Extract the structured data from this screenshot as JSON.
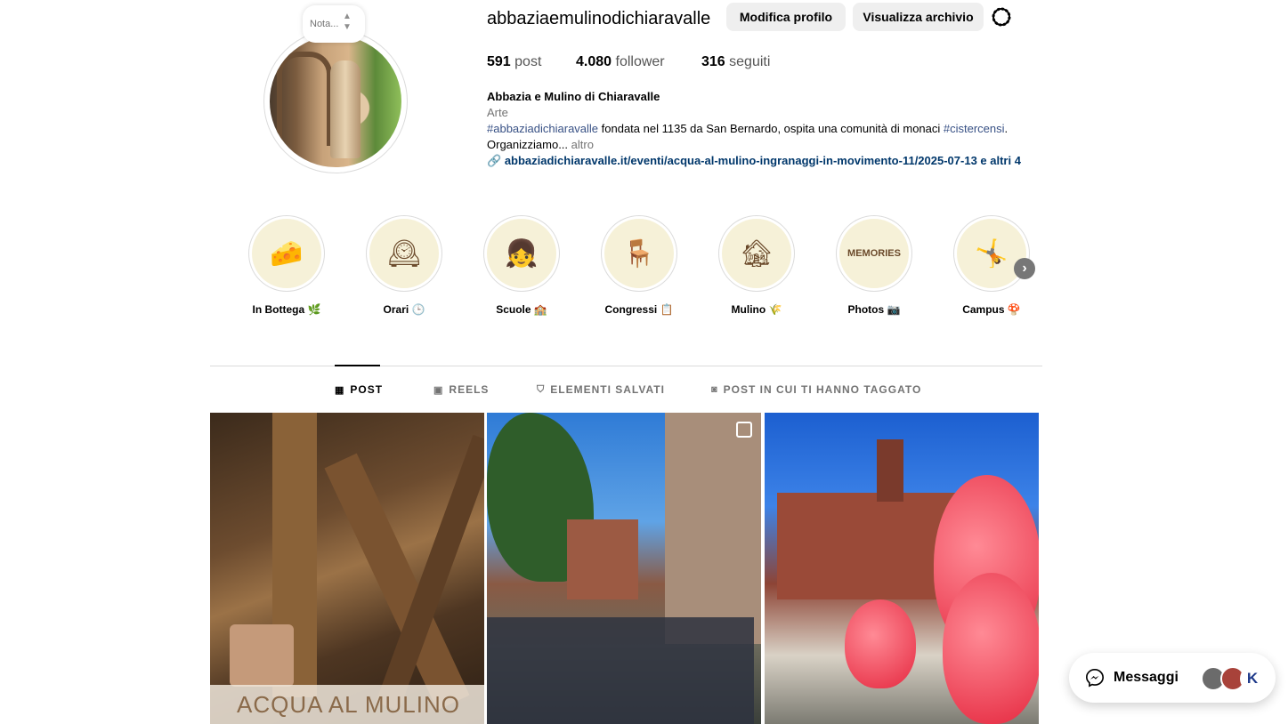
{
  "profile": {
    "username": "abbaziaemulinodichiaravalle",
    "note_text": "Nota...",
    "edit_button": "Modifica profilo",
    "archive_button": "Visualizza archivio",
    "stats": {
      "posts_value": "591",
      "posts_label": "post",
      "followers_value": "4.080",
      "followers_label": "follower",
      "following_value": "316",
      "following_label": "seguiti"
    },
    "bio": {
      "name": "Abbazia e Mulino di Chiaravalle",
      "category": "Arte",
      "hashtag1": "#abbaziadichiaravalle",
      "text1": " fondata nel 1135 da San Bernardo, ospita una comunità di monaci ",
      "hashtag2": "#cistercensi",
      "text2": ".",
      "line2": "Organizziamo...",
      "more": " altro",
      "link": "abbaziadichiaravalle.it/eventi/acqua-al-mulino-ingranaggi-in-movimento-11/2025-07-13 e altri 4"
    }
  },
  "highlights": [
    {
      "label": "In Bottega 🌿",
      "icon": "🧀"
    },
    {
      "label": "Orari 🕒",
      "icon": "🕰"
    },
    {
      "label": "Scuole 🏫",
      "icon": "👧"
    },
    {
      "label": "Congressi 📋",
      "icon": "🪑"
    },
    {
      "label": "Mulino 🌾",
      "icon": "🏚"
    },
    {
      "label": "Photos 📷",
      "icon": "MEMORIES"
    },
    {
      "label": "Campus 🍄",
      "icon": "🤸"
    }
  ],
  "tabs": {
    "posts": "POST",
    "reels": "REELS",
    "saved": "ELEMENTI SALVATI",
    "tagged": "POST IN CUI TI HANNO TAGGATO"
  },
  "posts": {
    "post1_caption": "ACQUA AL MULINO"
  },
  "messages": {
    "label": "Messaggi",
    "avatar3_initial": "K"
  },
  "colors": {
    "link_blue": "#00376b",
    "hashtag_blue": "#385185",
    "button_gray": "#efefef",
    "highlight_bg": "#f6f1d8"
  }
}
